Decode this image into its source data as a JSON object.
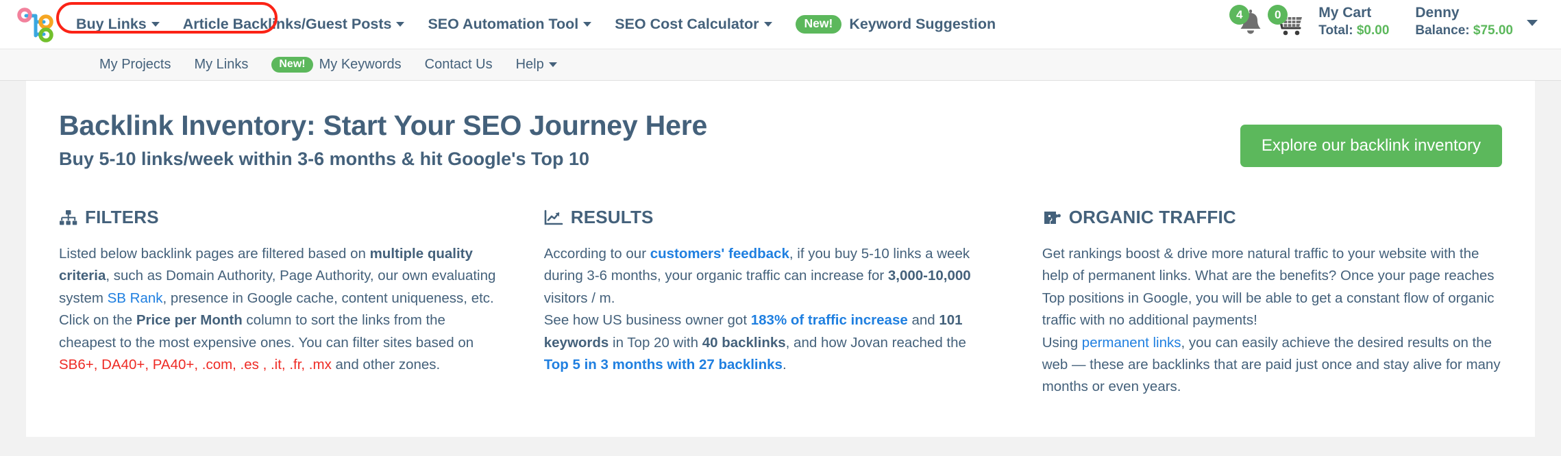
{
  "colors": {
    "brand_navy": "#44617b",
    "accent_green": "#5cb85c",
    "link_blue": "#1f7fe0",
    "alert_red": "#ee2b25",
    "highlight_red": "#fb2316"
  },
  "topbar": {
    "logo_name": "seo-site-logo",
    "primary_nav": [
      {
        "label": "Buy Links",
        "caret": true,
        "badge": null
      },
      {
        "label": "Article Backlinks/Guest Posts",
        "caret": true,
        "badge": null
      },
      {
        "label": "SEO Automation Tool",
        "caret": true,
        "badge": null
      },
      {
        "label": "SEO Cost Calculator",
        "caret": true,
        "badge": null
      },
      {
        "label": "Keyword Suggestion",
        "caret": false,
        "badge": "New!"
      }
    ],
    "notifications": {
      "icon": "bell-icon",
      "count": "4"
    },
    "cart": {
      "icon": "shopping-cart-icon",
      "count": "0",
      "title": "My Cart",
      "total_label": "Total:",
      "total_value": "$0.00"
    },
    "user": {
      "name": "Denny",
      "balance_label": "Balance:",
      "balance_value": "$75.00",
      "caret": true
    }
  },
  "subnav": {
    "items": [
      {
        "label": "My Projects",
        "caret": false,
        "badge": null
      },
      {
        "label": "My Links",
        "caret": false,
        "badge": null
      },
      {
        "label": "My Keywords",
        "caret": false,
        "badge": "New!"
      },
      {
        "label": "Contact Us",
        "caret": false,
        "badge": null
      },
      {
        "label": "Help",
        "caret": true,
        "badge": null
      }
    ]
  },
  "hero": {
    "title": "Backlink Inventory: Start Your SEO Journey Here",
    "subtitle": "Buy 5-10 links/week within 3-6 months & hit Google's Top 10",
    "cta_label": "Explore our backlink inventory"
  },
  "columns": [
    {
      "icon": "sitemap-icon",
      "heading": "FILTERS",
      "paragraphs": [
        {
          "parts": [
            {
              "t": "Listed below backlink pages are filtered based on ",
              "s": "plain"
            },
            {
              "t": "multiple quality criteria",
              "s": "bold"
            },
            {
              "t": ", such as Domain Authority, Page Authority, our own evaluating system ",
              "s": "plain"
            },
            {
              "t": "SB Rank",
              "s": "link"
            },
            {
              "t": ", presence in Google cache, content uniqueness, etc.",
              "s": "plain"
            }
          ]
        },
        {
          "parts": [
            {
              "t": "Click on the ",
              "s": "plain"
            },
            {
              "t": "Price per Month",
              "s": "bold"
            },
            {
              "t": " column to sort the links from the cheapest to the most expensive ones. You can filter sites based on ",
              "s": "plain"
            },
            {
              "t": "SB6+, DA40+, PA40+, .com, .es , .it, .fr, .mx",
              "s": "red"
            },
            {
              "t": " and other zones.",
              "s": "plain"
            }
          ]
        }
      ]
    },
    {
      "icon": "chart-line-icon",
      "heading": "RESULTS",
      "paragraphs": [
        {
          "parts": [
            {
              "t": "According to our ",
              "s": "plain"
            },
            {
              "t": "customers' feedback",
              "s": "linkbold"
            },
            {
              "t": ", if you buy 5-10 links a week during 3-6 months, your organic traffic can increase for ",
              "s": "plain"
            },
            {
              "t": "3,000-10,000",
              "s": "bold"
            },
            {
              "t": " visitors / m.",
              "s": "plain"
            }
          ]
        },
        {
          "parts": [
            {
              "t": "See how US business owner got ",
              "s": "plain"
            },
            {
              "t": "183% of traffic increase",
              "s": "linkbold"
            },
            {
              "t": " and ",
              "s": "plain"
            },
            {
              "t": "101 keywords",
              "s": "bold"
            },
            {
              "t": " in Top 20 with ",
              "s": "plain"
            },
            {
              "t": "40 backlinks",
              "s": "bold"
            },
            {
              "t": ", and how Jovan reached the ",
              "s": "plain"
            },
            {
              "t": "Top 5 in 3 months with 27 backlinks",
              "s": "linkbold"
            },
            {
              "t": ".",
              "s": "plain"
            }
          ]
        }
      ]
    },
    {
      "icon": "puzzle-piece-icon",
      "heading": "ORGANIC TRAFFIC",
      "paragraphs": [
        {
          "parts": [
            {
              "t": "Get rankings boost & drive more natural traffic to your website with the help of permanent links. What are the benefits? Once your page reaches Top positions in Google, you will be able to get a constant flow of organic traffic with no additional payments!",
              "s": "plain"
            }
          ]
        },
        {
          "parts": [
            {
              "t": "Using ",
              "s": "plain"
            },
            {
              "t": "permanent links",
              "s": "link"
            },
            {
              "t": ", you can easily achieve the desired results on the web — these are backlinks that are paid just once and stay alive for many months or even years.",
              "s": "plain"
            }
          ]
        }
      ]
    }
  ]
}
